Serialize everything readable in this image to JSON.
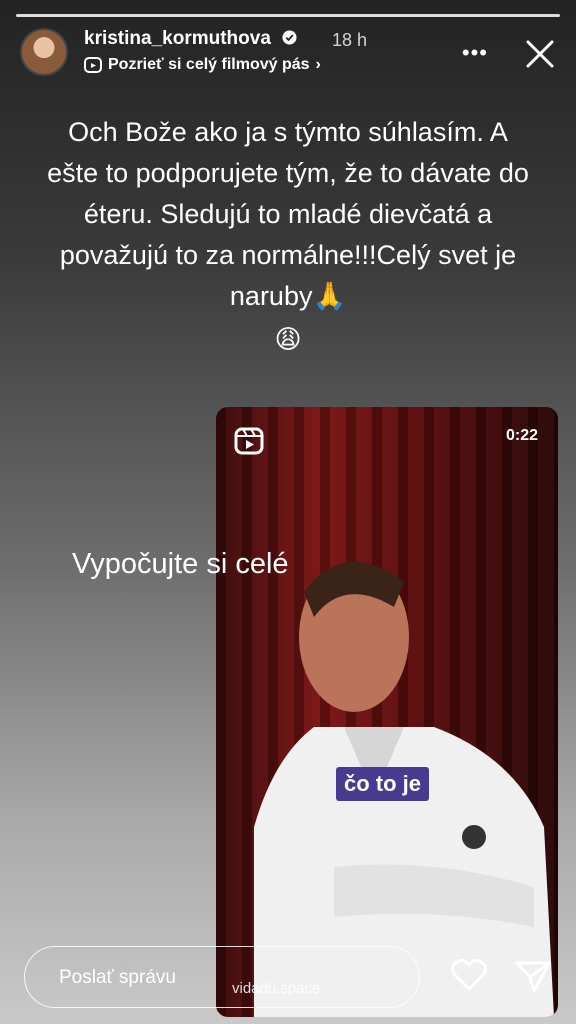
{
  "header": {
    "username": "kristina_kormuthova",
    "time": "18 h",
    "subtitle": "Pozrieť si celý filmový pás",
    "more_label": "•••"
  },
  "story": {
    "text": "Och Bože ako ja s týmto súhlasím. A ešte to podporujete tým, že to dávate do éteru. Sledujú to mladé dievčatá a považujú to za normálne!!!Celý svet je naruby🙏",
    "emoji": "😩",
    "overlay_text": "Vypočujte si celé"
  },
  "reel": {
    "duration": "0:22",
    "caption": "čo to je",
    "watermark": "vidadu.space"
  },
  "footer": {
    "message_placeholder": "Poslať správu"
  },
  "icons": [
    "verified-icon",
    "reels-icon",
    "chevron-right-icon",
    "more-icon",
    "close-icon",
    "heart-icon",
    "send-icon"
  ]
}
